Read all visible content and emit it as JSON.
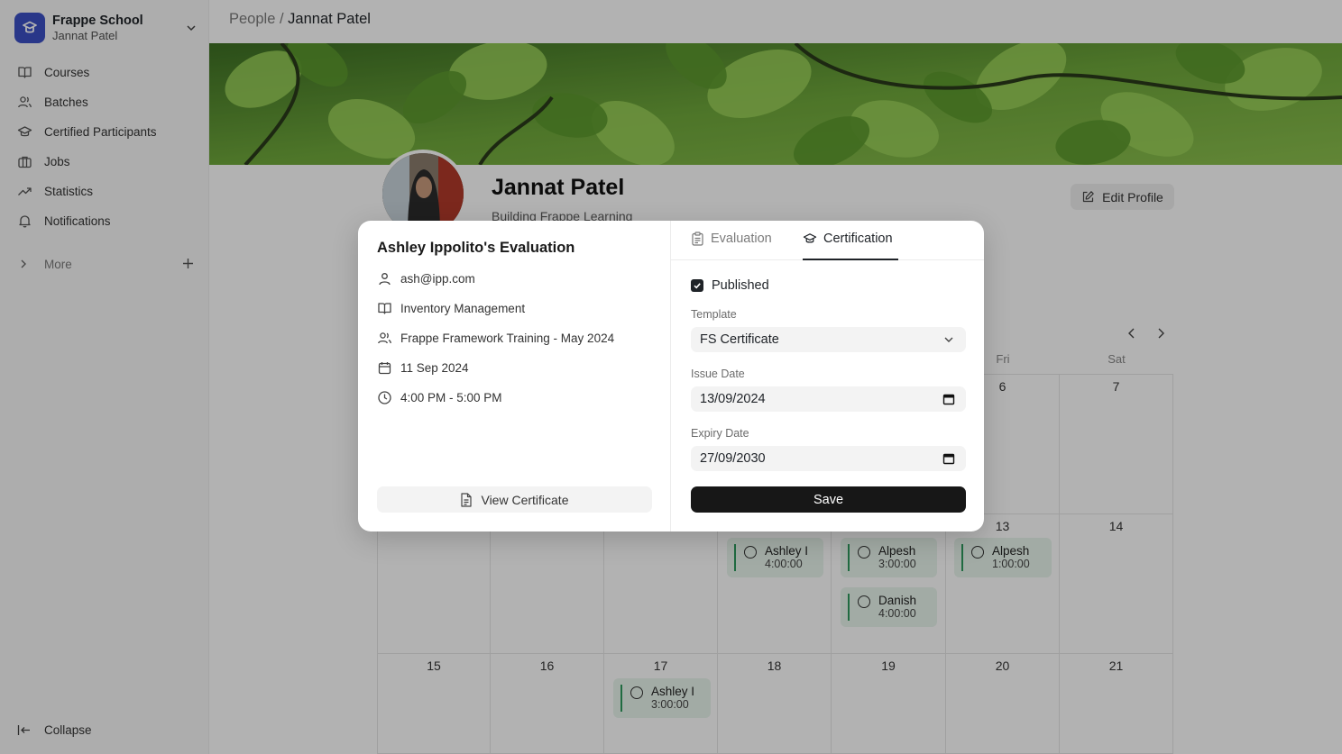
{
  "sidebar": {
    "brand_name": "Frappe School",
    "brand_user": "Jannat Patel",
    "items": [
      {
        "label": "Courses"
      },
      {
        "label": "Batches"
      },
      {
        "label": "Certified Participants"
      },
      {
        "label": "Jobs"
      },
      {
        "label": "Statistics"
      },
      {
        "label": "Notifications"
      }
    ],
    "more_label": "More",
    "collapse_label": "Collapse"
  },
  "breadcrumb": {
    "parent": "People",
    "separator": "/",
    "current": "Jannat Patel"
  },
  "profile": {
    "name": "Jannat Patel",
    "bio": "Building Frappe Learning",
    "edit_label": "Edit Profile"
  },
  "calendar": {
    "day_headers": {
      "fri": "Fri",
      "sat": "Sat"
    },
    "dates": {
      "d6": "6",
      "d7": "7",
      "d13": "13",
      "d14": "14",
      "d15": "15",
      "d16": "16",
      "d17": "17",
      "d18": "18",
      "d19": "19",
      "d20": "20",
      "d21": "21"
    },
    "events": [
      {
        "name": "Ashley I",
        "time": "4:00:00"
      },
      {
        "name": "Alpesh",
        "time": "3:00:00"
      },
      {
        "name": "Danish",
        "time": "4:00:00"
      },
      {
        "name": "Alpesh",
        "time": "1:00:00"
      },
      {
        "name": "Ashley I",
        "time": "3:00:00"
      }
    ]
  },
  "modal": {
    "title": "Ashley Ippolito's Evaluation",
    "email": "ash@ipp.com",
    "course": "Inventory Management",
    "batch": "Frappe Framework Training - May 2024",
    "date": "11 Sep 2024",
    "time": "4:00 PM - 5:00 PM",
    "view_certificate": "View Certificate",
    "tabs": {
      "evaluation": "Evaluation",
      "certification": "Certification"
    },
    "published_label": "Published",
    "template_label": "Template",
    "template_value": "FS Certificate",
    "issue_date_label": "Issue Date",
    "issue_date_value": "13/09/2024",
    "expiry_date_label": "Expiry Date",
    "expiry_date_value": "27/09/2030",
    "save_label": "Save"
  },
  "colors": {
    "brand": "#3b4fc4",
    "event_bg": "#e8f5ec",
    "event_bar": "#2f9a5e",
    "primary_button": "#171717"
  }
}
